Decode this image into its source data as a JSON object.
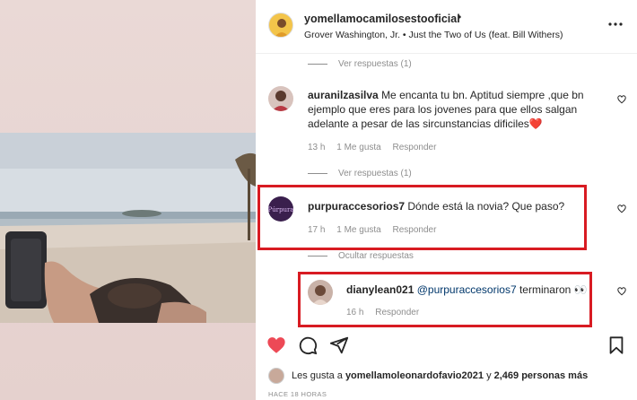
{
  "post": {
    "username": "yomellamocamilosestooficial",
    "dot": "•",
    "song": "Grover Washington, Jr. • Just the Two of Us (feat. Bill Withers)"
  },
  "view_replies_top": "Ver respuestas (1)",
  "comments": [
    {
      "username": "auranilzasilva",
      "text": "Me encanta tu bn. Aptitud siempre ,que bn ejemplo que eres para los jovenes para que ellos salgan adelante a pesar de las sircunstancias dificiles",
      "emoji": "❤️",
      "time": "13 h",
      "likes": "1 Me gusta",
      "reply": "Responder",
      "view_replies": "Ver respuestas (1)"
    },
    {
      "username": "purpuraccesorios7",
      "text": "Dónde está la novia? Que paso?",
      "time": "17 h",
      "likes": "1 Me gusta",
      "reply": "Responder",
      "hide_replies": "Ocultar respuestas"
    }
  ],
  "reply": {
    "username": "dianylean021",
    "mention": "@purpuraccesorios7",
    "text": "terminaron",
    "emoji": "👀",
    "time": "16 h",
    "reply": "Responder"
  },
  "likes": {
    "prefix": "Les gusta a",
    "user": "yomellamoleonardofavio2021",
    "middle": "y",
    "count": "2,469 personas más"
  },
  "timestamp": "HACE 18 HORAS",
  "icons": {
    "like": "heart-icon-filled",
    "comment": "comment-icon",
    "share": "share-icon",
    "save": "bookmark-icon",
    "more": "more-icon"
  },
  "colors": {
    "like_red": "#ed4956",
    "highlight_red": "#d81b22",
    "mention_blue": "#00376b"
  }
}
